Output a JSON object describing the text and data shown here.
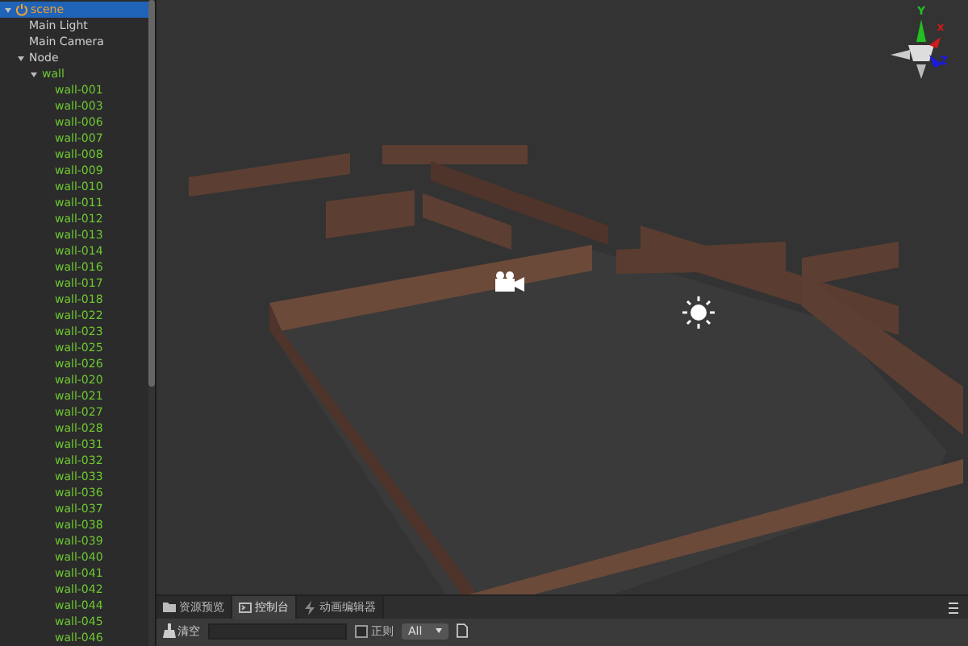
{
  "hierarchy": {
    "items": [
      {
        "label": "scene",
        "kind": "scene",
        "selected": true,
        "expanded": true,
        "children": [
          {
            "label": "Main Light",
            "kind": "node",
            "selected": false
          },
          {
            "label": "Main Camera",
            "kind": "node",
            "selected": false
          },
          {
            "label": "Node",
            "kind": "node",
            "selected": false,
            "expanded": true,
            "children": [
              {
                "label": "wall",
                "kind": "prefab",
                "selected": false,
                "expanded": true,
                "children": [
                  {
                    "label": "wall-001",
                    "kind": "prefab",
                    "selected": false
                  },
                  {
                    "label": "wall-003",
                    "kind": "prefab",
                    "selected": false
                  },
                  {
                    "label": "wall-006",
                    "kind": "prefab",
                    "selected": false
                  },
                  {
                    "label": "wall-007",
                    "kind": "prefab",
                    "selected": false
                  },
                  {
                    "label": "wall-008",
                    "kind": "prefab",
                    "selected": false
                  },
                  {
                    "label": "wall-009",
                    "kind": "prefab",
                    "selected": false
                  },
                  {
                    "label": "wall-010",
                    "kind": "prefab",
                    "selected": false
                  },
                  {
                    "label": "wall-011",
                    "kind": "prefab",
                    "selected": false
                  },
                  {
                    "label": "wall-012",
                    "kind": "prefab",
                    "selected": false
                  },
                  {
                    "label": "wall-013",
                    "kind": "prefab",
                    "selected": false
                  },
                  {
                    "label": "wall-014",
                    "kind": "prefab",
                    "selected": false
                  },
                  {
                    "label": "wall-016",
                    "kind": "prefab",
                    "selected": false
                  },
                  {
                    "label": "wall-017",
                    "kind": "prefab",
                    "selected": false
                  },
                  {
                    "label": "wall-018",
                    "kind": "prefab",
                    "selected": false
                  },
                  {
                    "label": "wall-022",
                    "kind": "prefab",
                    "selected": false
                  },
                  {
                    "label": "wall-023",
                    "kind": "prefab",
                    "selected": false
                  },
                  {
                    "label": "wall-025",
                    "kind": "prefab",
                    "selected": false
                  },
                  {
                    "label": "wall-026",
                    "kind": "prefab",
                    "selected": false
                  },
                  {
                    "label": "wall-020",
                    "kind": "prefab",
                    "selected": false
                  },
                  {
                    "label": "wall-021",
                    "kind": "prefab",
                    "selected": false
                  },
                  {
                    "label": "wall-027",
                    "kind": "prefab",
                    "selected": false
                  },
                  {
                    "label": "wall-028",
                    "kind": "prefab",
                    "selected": false
                  },
                  {
                    "label": "wall-031",
                    "kind": "prefab",
                    "selected": false
                  },
                  {
                    "label": "wall-032",
                    "kind": "prefab",
                    "selected": false
                  },
                  {
                    "label": "wall-033",
                    "kind": "prefab",
                    "selected": false
                  },
                  {
                    "label": "wall-036",
                    "kind": "prefab",
                    "selected": false
                  },
                  {
                    "label": "wall-037",
                    "kind": "prefab",
                    "selected": false
                  },
                  {
                    "label": "wall-038",
                    "kind": "prefab",
                    "selected": false
                  },
                  {
                    "label": "wall-039",
                    "kind": "prefab",
                    "selected": false
                  },
                  {
                    "label": "wall-040",
                    "kind": "prefab",
                    "selected": false
                  },
                  {
                    "label": "wall-041",
                    "kind": "prefab",
                    "selected": false
                  },
                  {
                    "label": "wall-042",
                    "kind": "prefab",
                    "selected": false
                  },
                  {
                    "label": "wall-044",
                    "kind": "prefab",
                    "selected": false
                  },
                  {
                    "label": "wall-045",
                    "kind": "prefab",
                    "selected": false
                  },
                  {
                    "label": "wall-046",
                    "kind": "prefab",
                    "selected": false
                  }
                ]
              }
            ]
          }
        ]
      }
    ]
  },
  "scene_view": {
    "gizmo_axes": [
      {
        "label": "Y",
        "color": "#22c022"
      },
      {
        "label": "x",
        "color": "#d01a1a"
      },
      {
        "label": "Z",
        "color": "#1a1ae0"
      }
    ]
  },
  "bottom_panel": {
    "tabs": [
      {
        "label": "资源预览",
        "kind": "folder",
        "selected": false
      },
      {
        "label": "控制台",
        "kind": "console",
        "selected": true
      },
      {
        "label": "动画编辑器",
        "kind": "animation",
        "selected": false
      }
    ],
    "clear_button": "清空",
    "regex": {
      "label": "正则",
      "checked": false
    },
    "level_select": "All"
  }
}
